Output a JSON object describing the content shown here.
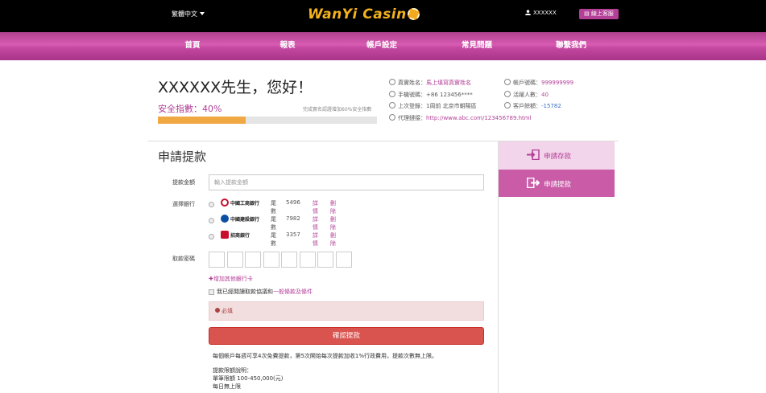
{
  "topbar": {
    "language": "繁體中文",
    "logo_text": "WanYi Casin",
    "username": "XXXXXX",
    "cs_button": "線上客服"
  },
  "nav": {
    "items": [
      "首頁",
      "報表",
      "帳戶設定",
      "常見問題",
      "聯繫我們"
    ]
  },
  "greeting": {
    "text": "XXXXXX先生，您好！",
    "security_label": "安全指數：40%",
    "security_tip": "完成實名認證增加60%安全指數",
    "security_percent": 40
  },
  "info": {
    "real_name_label": "真實姓名：",
    "real_name_value": "馬上填寫真實姓名",
    "phone_label": "手機號碼：",
    "phone_value": "+86 123456****",
    "last_login_label": "上次登錄：",
    "last_login_value": "1周前 北京市朝陽區",
    "agent_link_label": "代理鏈接：",
    "agent_link_value": "http://www.abc.com/123456789.html",
    "account_no_label": "帳戶號碼：",
    "account_no_value": "999999999",
    "active_label": "活躍人數：",
    "active_value": "40",
    "balance_label": "客戶餘額：",
    "balance_value": "-15782"
  },
  "side_menu": {
    "deposit": "申請存款",
    "withdraw": "申請提款"
  },
  "form": {
    "title": "申請提款",
    "amount_label": "提款金額",
    "amount_placeholder": "輸入提款金額",
    "bank_label": "選擇銀行",
    "banks": [
      {
        "name": "中國工商銀行",
        "tail_label": "尾數",
        "tail": "5496",
        "detail": "詳情",
        "delete": "刪除",
        "color": "#c8102e"
      },
      {
        "name": "中國建設銀行",
        "tail_label": "尾數",
        "tail": "7982",
        "detail": "詳情",
        "delete": "刪除",
        "color": "#0a4fa3"
      },
      {
        "name": "招商銀行",
        "tail_label": "尾數",
        "tail": "3357",
        "detail": "詳情",
        "delete": "刪除",
        "color": "#c8102e"
      }
    ],
    "password_label": "取款密碼",
    "add_card": "✚增加其他銀行卡",
    "agree_text": "我已經閱讀取款協議和",
    "agree_link": "一般條款及條件",
    "error_text": "必填",
    "submit": "確認提款",
    "note_line1": "每個帳戶每週可享4次免費提款，第5次開始每次提款加收1%行政費用，提款次數無上限。",
    "note_line2": "提款限額說明：",
    "note_line3": "單筆限額 100-450,000(元)",
    "note_line4": "每日無上限"
  },
  "colors": {
    "brand": "#b33f97",
    "progress": "#f0a842",
    "submit": "#d9534f"
  }
}
